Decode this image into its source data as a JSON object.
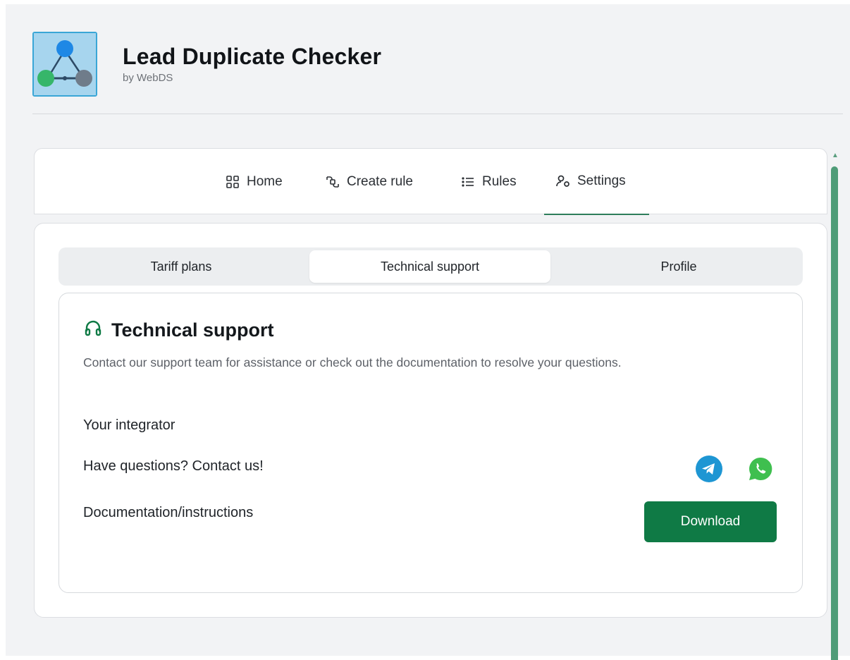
{
  "app": {
    "title": "Lead Duplicate Checker",
    "vendor": "by WebDS"
  },
  "nav": {
    "items": [
      {
        "label": "Home",
        "icon": "grid-icon"
      },
      {
        "label": "Create rule",
        "icon": "link-icon"
      },
      {
        "label": "Rules",
        "icon": "list-icon"
      },
      {
        "label": "Settings",
        "icon": "user-settings-icon"
      }
    ],
    "active": "Settings"
  },
  "settings_tabs": {
    "items": [
      "Tariff plans",
      "Technical support",
      "Profile"
    ],
    "active": "Technical support"
  },
  "support": {
    "title": "Technical support",
    "description": "Contact our support team for assistance or check out the documentation to resolve your questions.",
    "integrator_label": "Your integrator",
    "contact_label": "Have questions? Contact us!",
    "docs_label": "Documentation/instructions",
    "download_label": "Download"
  },
  "colors": {
    "accent": "#0f7a45",
    "scrollbar": "#4f9c78",
    "telegram": "#1e96d3",
    "whatsapp": "#3fbf4f"
  }
}
